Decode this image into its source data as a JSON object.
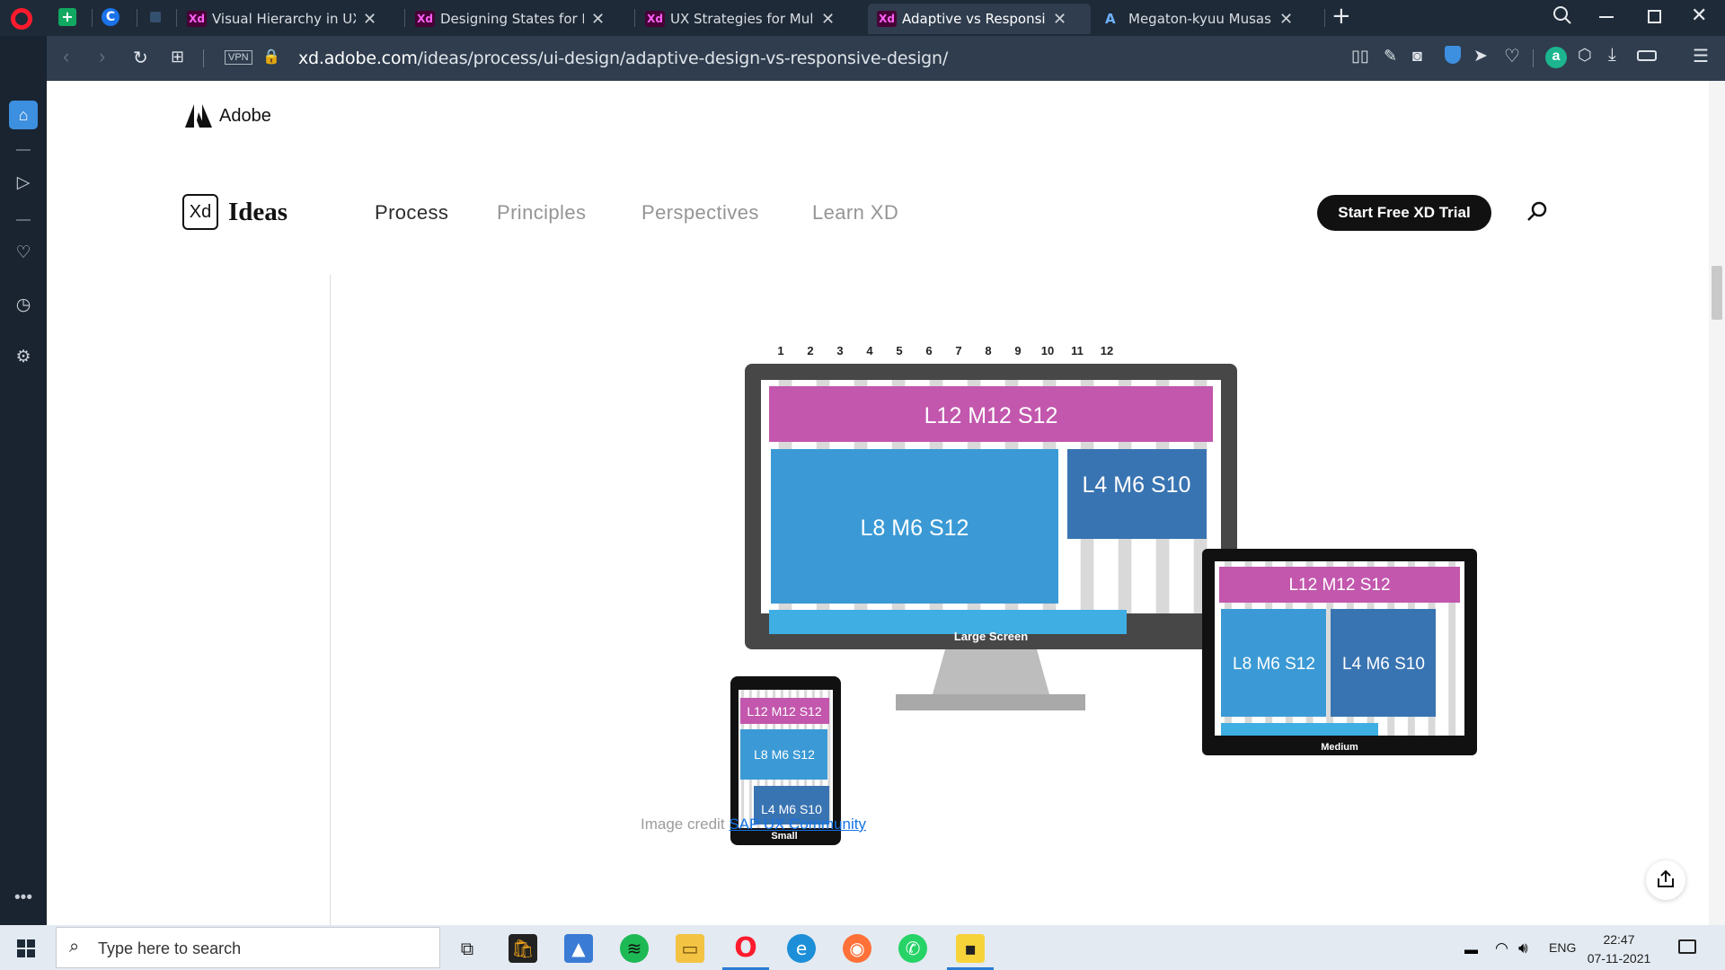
{
  "browser": {
    "tabs": [
      {
        "label": "Visual Hierarchy in UX Desi",
        "icon": "xd-favicon"
      },
      {
        "label": "Designing States for Button",
        "icon": "xd-favicon"
      },
      {
        "label": "UX Strategies for Multiple D",
        "icon": "xd-favicon"
      },
      {
        "label": "Adaptive vs Responsive De",
        "icon": "xd-favicon",
        "active": true
      },
      {
        "label": "Megaton-kyuu Musashi Epi",
        "icon": "anime-favicon"
      }
    ],
    "url_host": "xd.adobe.com",
    "url_path": "/ideas/process/ui-design/adaptive-design-vs-responsive-design/",
    "vpn_label": "VPN"
  },
  "site": {
    "adobe_label": "Adobe",
    "xd_badge": "Xd",
    "ideas_label": "Ideas",
    "nav": [
      "Process",
      "Principles",
      "Perspectives",
      "Learn XD"
    ],
    "cta": "Start Free XD Trial"
  },
  "figure": {
    "columns": [
      "1",
      "2",
      "3",
      "4",
      "5",
      "6",
      "7",
      "8",
      "9",
      "10",
      "11",
      "12"
    ],
    "large": {
      "row1": "L12 M12 S12",
      "main": "L8 M6 S12",
      "side": "L4 M6 S10",
      "caption": "Large Screen"
    },
    "medium": {
      "row1": "L12 M12 S12",
      "main": "L8 M6 S12",
      "side": "L4 M6 S10",
      "caption": "Medium"
    },
    "small": {
      "row1": "L12 M12 S12",
      "main": "L8 M6 S12",
      "side": "L4 M6 S10",
      "caption": "Small"
    },
    "colors": {
      "magenta": "#c257ad",
      "blue": "#3b9ad5",
      "navy": "#3974b2",
      "cyan": "#3eaee3",
      "frame": "#474747"
    }
  },
  "credit": {
    "prefix": "Image credit",
    "link": "SAP UX Community"
  },
  "taskbar": {
    "search_placeholder": "Type here to search",
    "lang": "ENG",
    "time": "22:47",
    "date": "07-11-2021"
  }
}
